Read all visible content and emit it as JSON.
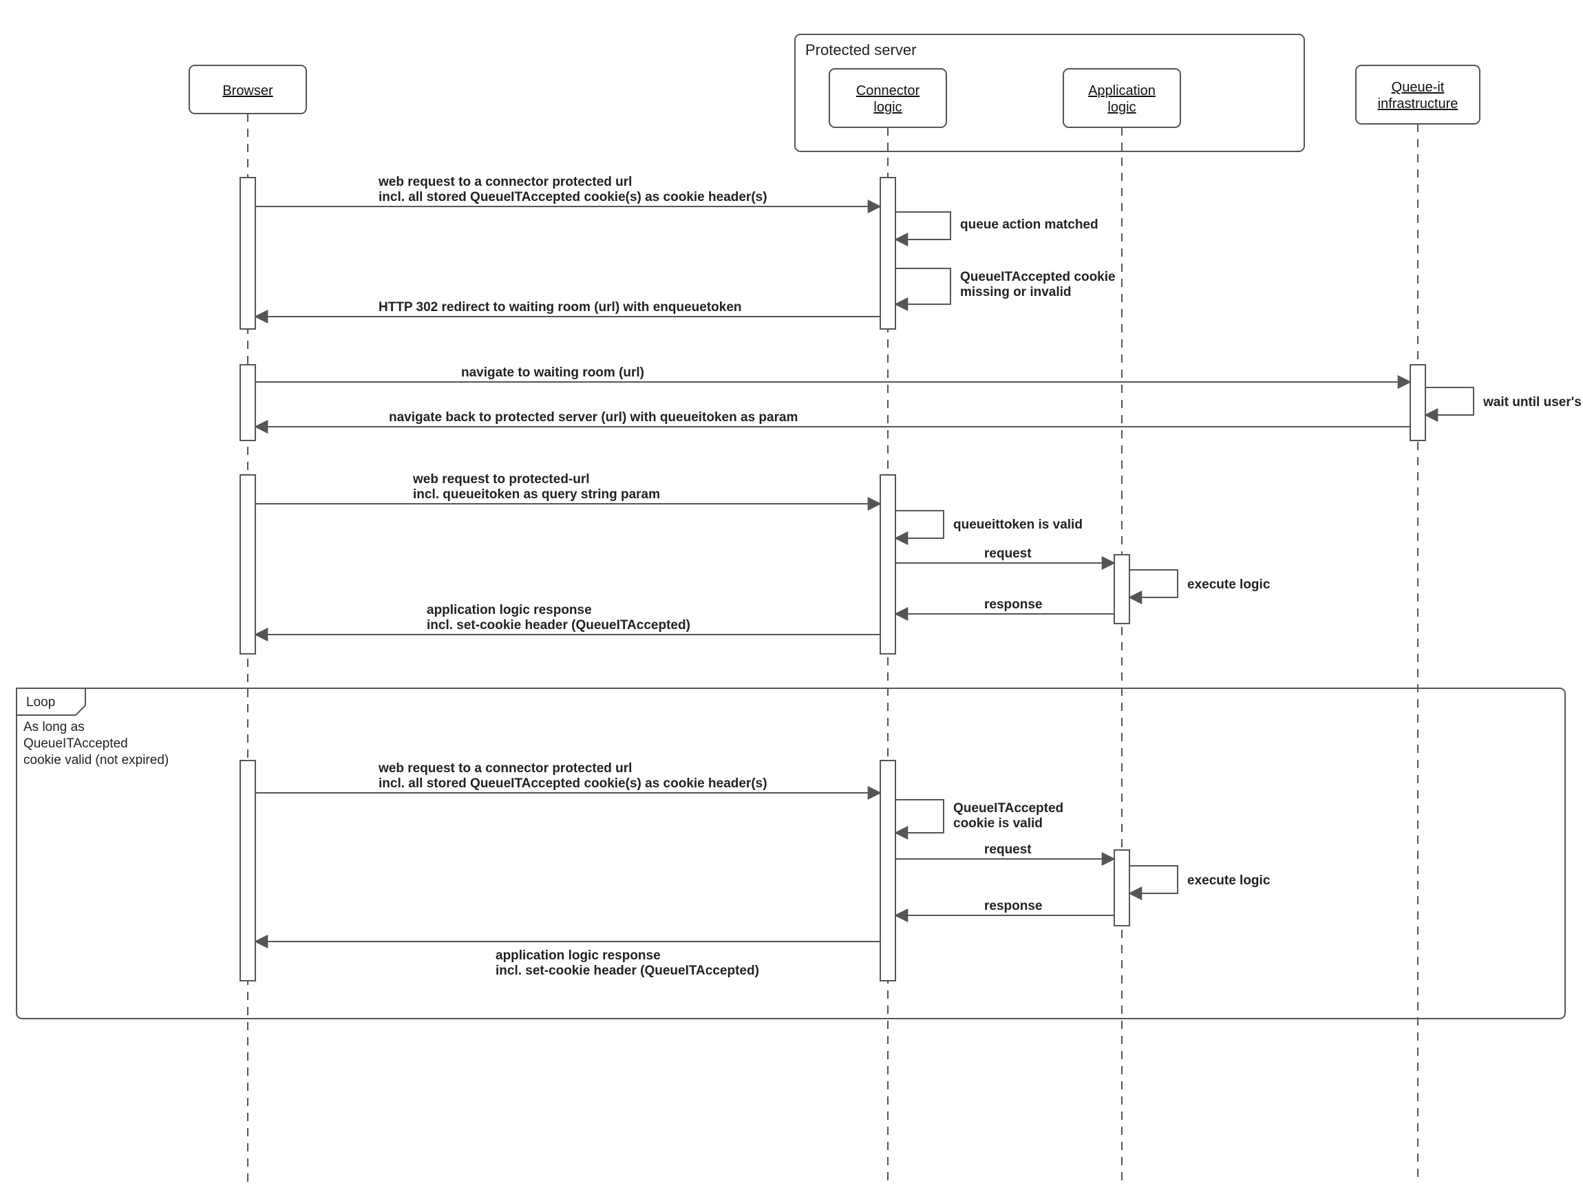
{
  "actors": {
    "browser": "Browser",
    "connector": "Connector",
    "connector2": "logic",
    "application": "Application",
    "application2": "logic",
    "queueit": "Queue-it",
    "queueit2": "infrastructure"
  },
  "container": {
    "title": "Protected server"
  },
  "loop": {
    "tab": "Loop",
    "line1": "As long as",
    "line2": "QueueITAccepted",
    "line3": "cookie valid (not expired)"
  },
  "msgs": {
    "m1a": "web request to a connector protected url",
    "m1b": "incl. all stored QueueITAccepted cookie(s) as cookie header(s)",
    "s1": "queue action matched",
    "s2a": "QueueITAccepted cookie",
    "s2b": "missing or invalid",
    "m2": "HTTP 302 redirect to waiting room (url) with enqueuetoken",
    "m3": "navigate to waiting room (url)",
    "s3": "wait until user's turn",
    "m4": "navigate back to protected server (url) with queueitoken as param",
    "m5a": "web request to protected-url",
    "m5b": "incl. queueitoken as query string param",
    "s4": "queueittoken is valid",
    "m6": "request",
    "s5": "execute logic",
    "m7": "response",
    "m8a": "application logic response",
    "m8b": "incl. set-cookie header (QueueITAccepted)",
    "L1a": "web request to a connector protected url",
    "L1b": "incl. all stored QueueITAccepted cookie(s) as cookie header(s)",
    "Ls1a": "QueueITAccepted",
    "Ls1b": "cookie is valid",
    "L2": "request",
    "Ls2": "execute logic",
    "L3": "response",
    "L4a": "application logic response",
    "L4b": "incl. set-cookie header (QueueITAccepted)"
  }
}
